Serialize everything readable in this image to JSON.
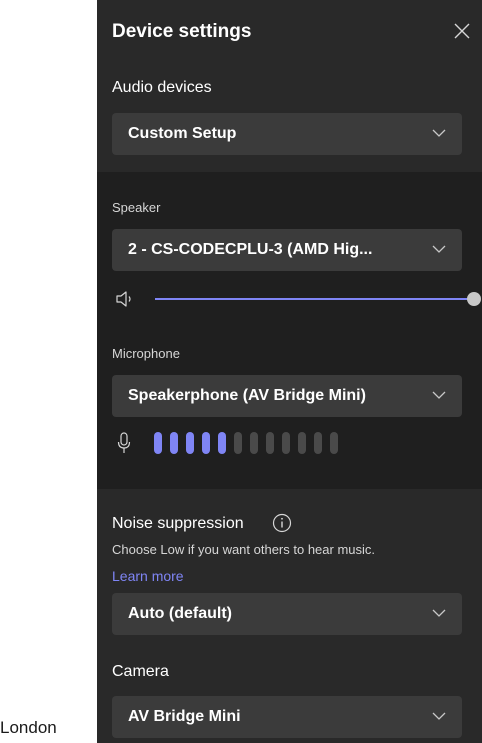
{
  "caption": "London",
  "panel": {
    "title": "Device settings",
    "audio_devices_label": "Audio devices",
    "audio_devices_value": "Custom Setup",
    "speaker_label": "Speaker",
    "speaker_value": "2 - CS-CODECPLU-3 (AMD Hig...",
    "speaker_volume_percent": 100,
    "microphone_label": "Microphone",
    "microphone_value": "Speakerphone (AV Bridge Mini)",
    "mic_level": {
      "active_bars": 5,
      "total_bars": 12
    },
    "noise_label": "Noise suppression",
    "noise_desc": "Choose Low if you want others to hear music.",
    "learn_more": "Learn more",
    "noise_value": "Auto (default)",
    "camera_label": "Camera",
    "camera_value": "AV Bridge Mini"
  },
  "colors": {
    "accent": "#7f85f5",
    "inactive_meter": "#4a4a4a",
    "panel_light": "#292929",
    "panel_dark": "#1f1f1f",
    "dropdown_bg": "#3b3b3b"
  },
  "icons": [
    "close-icon",
    "chevron-down-icon",
    "speaker-icon",
    "microphone-icon",
    "info-icon"
  ]
}
